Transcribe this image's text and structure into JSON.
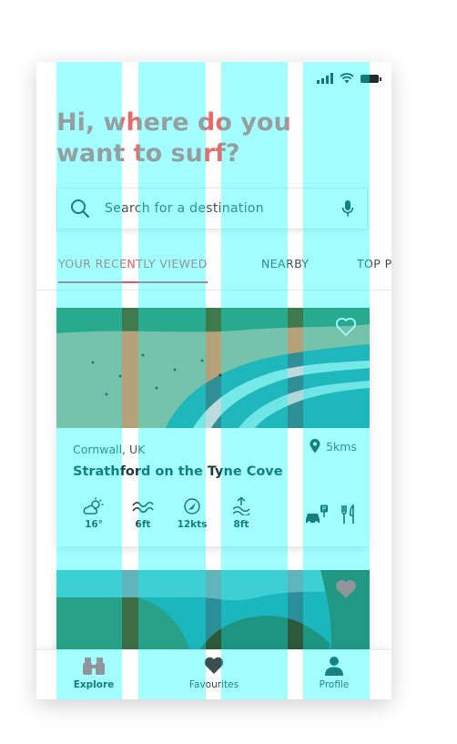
{
  "status_bar": {
    "icons": [
      "signal-icon",
      "wifi-icon",
      "battery-icon"
    ]
  },
  "greeting": "Hi, where do you want to surf?",
  "search": {
    "placeholder": "Search for a destination",
    "value": "",
    "icons": [
      "search-icon",
      "microphone-icon"
    ]
  },
  "tabs": [
    {
      "label": "YOUR RECENTLY VIEWED",
      "active": true
    },
    {
      "label": "NEARBY",
      "active": false
    },
    {
      "label": "TOP P",
      "active": false
    }
  ],
  "cards": [
    {
      "location": "Cornwall, UK",
      "distance": "5kms",
      "name": "Strathford on the Tyne Cove",
      "favourite": false,
      "conditions": [
        {
          "icon": "weather-sun-cloud-icon",
          "value": "16°"
        },
        {
          "icon": "wave-icon",
          "value": "6ft"
        },
        {
          "icon": "wind-compass-icon",
          "value": "12kts"
        },
        {
          "icon": "tide-icon",
          "value": "8ft"
        }
      ],
      "amenities": [
        "parking-icon",
        "restaurant-icon"
      ]
    },
    {
      "favourite": true
    }
  ],
  "bottom_nav": [
    {
      "label": "Explore",
      "icon": "binoculars-icon",
      "active": true
    },
    {
      "label": "Favourites",
      "icon": "heart-icon",
      "active": false
    },
    {
      "label": "Profile",
      "icon": "person-icon",
      "active": false
    }
  ],
  "colors": {
    "accent": "#e0595f",
    "heading": "#e86b6b",
    "text_dark": "#193b3b",
    "overlay_cyan": "#00ffff"
  }
}
